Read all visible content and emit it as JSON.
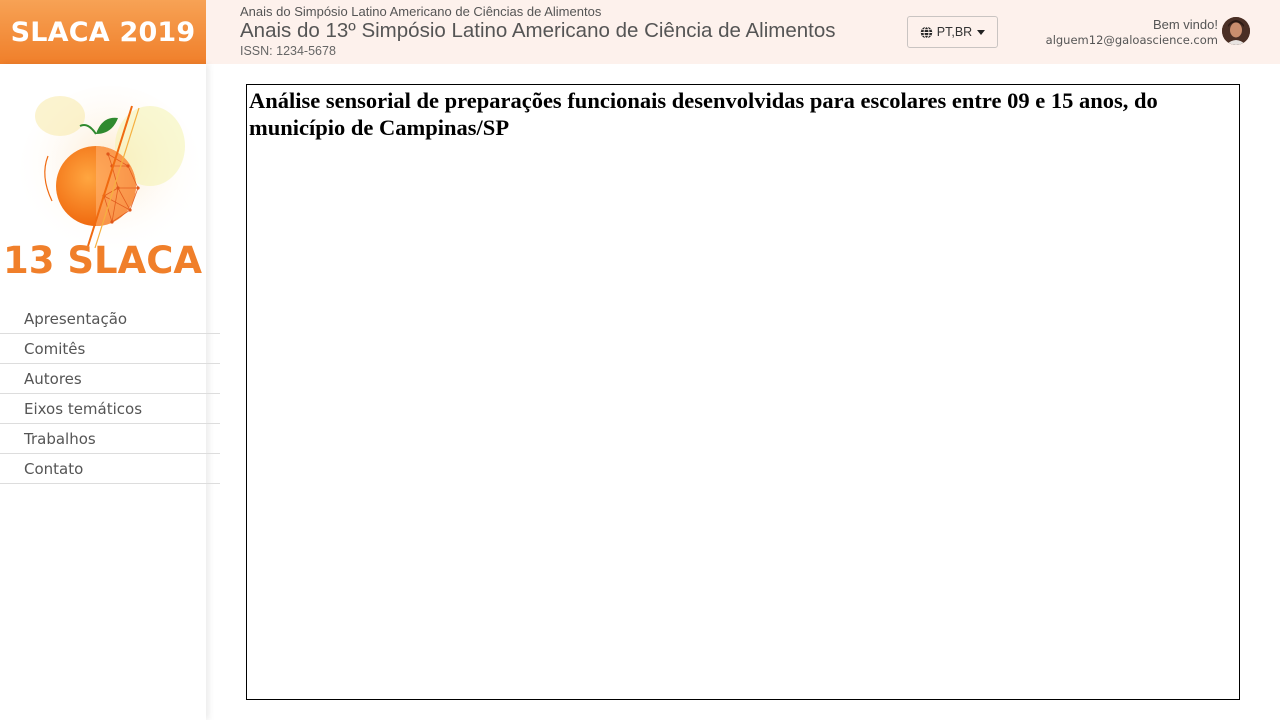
{
  "brand": {
    "label": "SLACA 2019"
  },
  "header": {
    "subtitle": "Anais do Simpósio Latino Americano de Ciências de Alimentos",
    "title": "Anais do 13º Simpósio Latino Americano de Ciência de Alimentos",
    "issn": "ISSN: 1234-5678"
  },
  "language": {
    "label": "PT,BR",
    "icon": "globe-icon"
  },
  "user": {
    "greeting": "Bem vindo!",
    "email": "alguem12@galoascience.com"
  },
  "logo": {
    "text": "13 SLACA"
  },
  "sidebar": {
    "items": [
      {
        "label": "Apresentação"
      },
      {
        "label": "Comitês"
      },
      {
        "label": "Autores"
      },
      {
        "label": "Eixos temáticos"
      },
      {
        "label": "Trabalhos"
      },
      {
        "label": "Contato"
      }
    ]
  },
  "main": {
    "title": "Análise sensorial de preparações funcionais desenvolvidas para escolares entre 09 e 15 anos, do município de Campinas/SP"
  },
  "colors": {
    "brand_orange": "#f07f2a",
    "header_bg": "#fdf1ec"
  }
}
